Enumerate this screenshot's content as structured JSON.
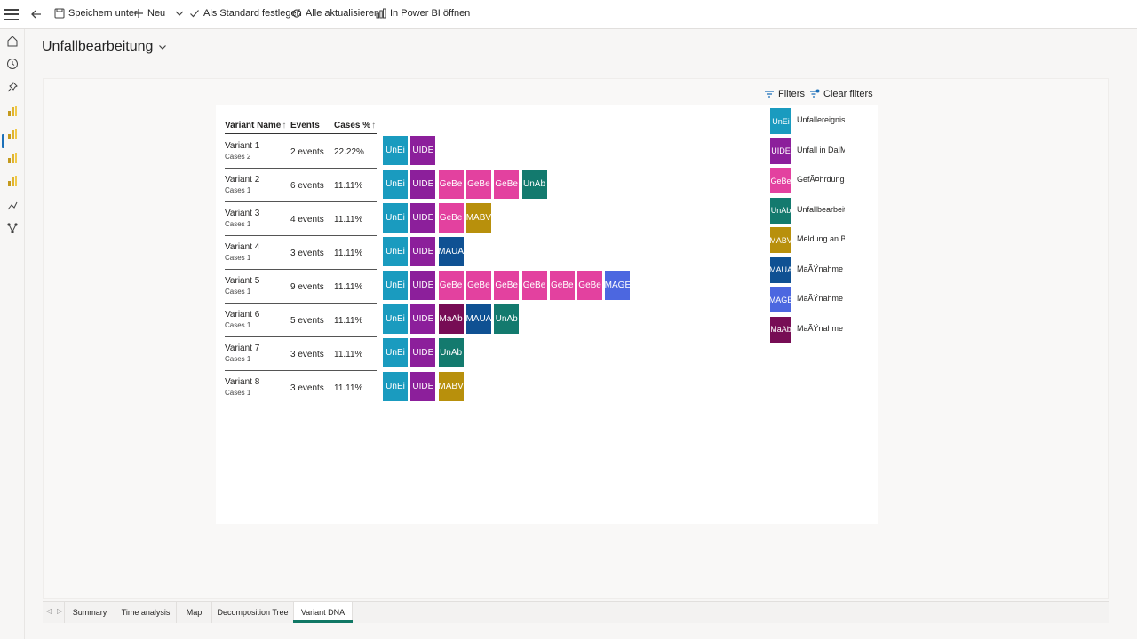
{
  "toolbar": {
    "save_as": "Speichern unter",
    "new": "Neu",
    "set_default": "Als Standard festlegen",
    "refresh_all": "Alle aktualisieren",
    "open_powerbi": "In Power BI öffnen"
  },
  "page": {
    "title": "Unfallbearbeitung"
  },
  "filters": {
    "filters_label": "Filters",
    "clear_label": "Clear filters"
  },
  "table": {
    "headers": {
      "name": "Variant Name",
      "events": "Events",
      "cases": "Cases %"
    },
    "rows": [
      {
        "name": "Variant 1",
        "sub": "Cases 2",
        "events": "2 events",
        "cases": "22.22%",
        "steps": [
          "UnEi",
          "UIDE"
        ]
      },
      {
        "name": "Variant 2",
        "sub": "Cases 1",
        "events": "6 events",
        "cases": "11.11%",
        "steps": [
          "UnEi",
          "UIDE",
          "GeBe",
          "GeBe",
          "GeBe",
          "UnAb"
        ]
      },
      {
        "name": "Variant 3",
        "sub": "Cases 1",
        "events": "4 events",
        "cases": "11.11%",
        "steps": [
          "UnEi",
          "UIDE",
          "GeBe",
          "MABV"
        ]
      },
      {
        "name": "Variant 4",
        "sub": "Cases 1",
        "events": "3 events",
        "cases": "11.11%",
        "steps": [
          "UnEi",
          "UIDE",
          "MAUA"
        ]
      },
      {
        "name": "Variant 5",
        "sub": "Cases 1",
        "events": "9 events",
        "cases": "11.11%",
        "steps": [
          "UnEi",
          "UIDE",
          "GeBe",
          "GeBe",
          "GeBe",
          "GeBe",
          "GeBe",
          "GeBe",
          "MAGE"
        ]
      },
      {
        "name": "Variant 6",
        "sub": "Cases 1",
        "events": "5 events",
        "cases": "11.11%",
        "steps": [
          "UnEi",
          "UIDE",
          "MaAb",
          "MAUA",
          "UnAb"
        ]
      },
      {
        "name": "Variant 7",
        "sub": "Cases 1",
        "events": "3 events",
        "cases": "11.11%",
        "steps": [
          "UnEi",
          "UIDE",
          "UnAb"
        ]
      },
      {
        "name": "Variant 8",
        "sub": "Cases 1",
        "events": "3 events",
        "cases": "11.11%",
        "steps": [
          "UnEi",
          "UIDE",
          "MABV"
        ]
      }
    ]
  },
  "colors": {
    "UnEi": "#1a9bbf",
    "UIDE": "#8c1f9b",
    "GeBe": "#e3419f",
    "UnAb": "#137a6e",
    "MABV": "#b8900c",
    "MAUA": "#0f5193",
    "MAGE": "#4c67e0",
    "MaAb": "#770d55"
  },
  "legend": [
    {
      "code": "UnEi",
      "label": "Unfallereignis e"
    },
    {
      "code": "UIDE",
      "label": "Unfall in DaIM"
    },
    {
      "code": "GeBe",
      "label": "GefÃ¤hrdungs"
    },
    {
      "code": "UnAb",
      "label": "Unfallbearbeitu"
    },
    {
      "code": "MABV",
      "label": "Meldung an BG"
    },
    {
      "code": "MAUA",
      "label": "MaÃŸnahme au"
    },
    {
      "code": "MAGE",
      "label": "MaÃŸnahme ge"
    },
    {
      "code": "MaAb",
      "label": "MaÃŸnahme ab"
    }
  ],
  "tabs": [
    "Summary",
    "Time analysis",
    "Map",
    "Decomposition Tree",
    "Variant DNA"
  ],
  "active_tab": "Variant DNA"
}
